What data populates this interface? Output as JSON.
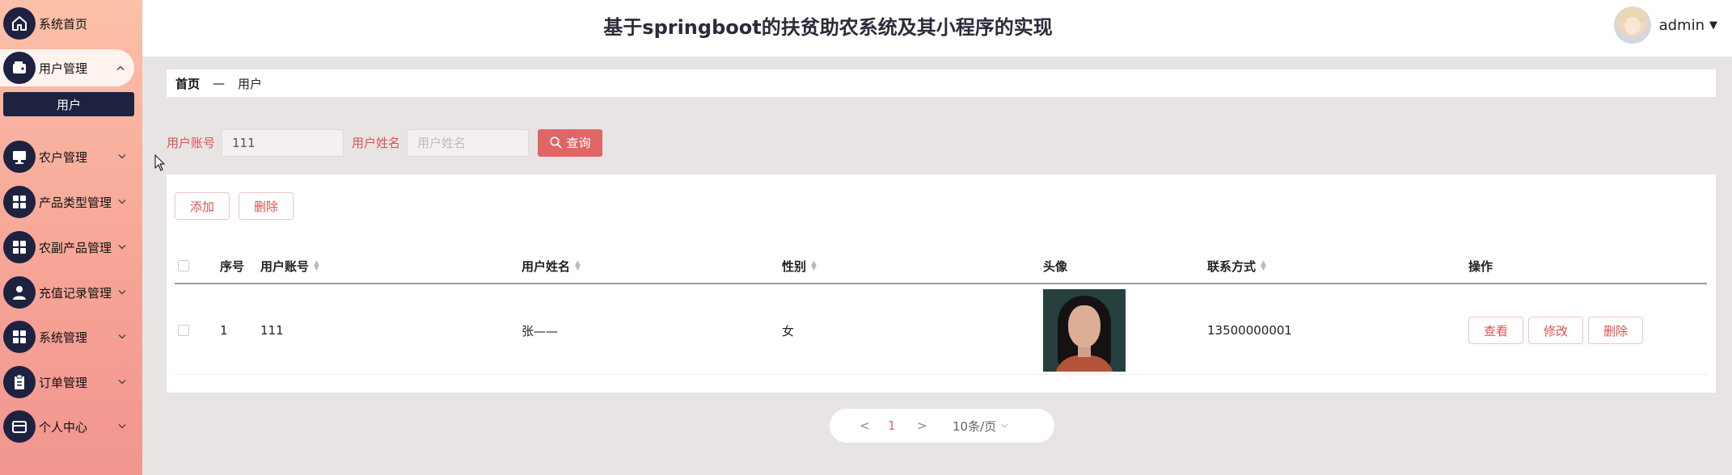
{
  "app": {
    "title": "基于springboot的扶贫助农系统及其小程序的实现"
  },
  "user": {
    "name": "admin",
    "caret": "▼"
  },
  "sidebar": {
    "items": [
      {
        "label": "系统首页",
        "icon": "home-icon"
      },
      {
        "label": "用户管理",
        "icon": "wallet-icon",
        "arrow": "^"
      },
      {
        "label": "农户管理",
        "icon": "monitor-icon",
        "arrow": "v"
      },
      {
        "label": "产品类型管理",
        "icon": "grid-icon",
        "arrow": "v"
      },
      {
        "label": "农副产品管理",
        "icon": "grid-icon",
        "arrow": "v"
      },
      {
        "label": "充值记录管理",
        "icon": "person-icon",
        "arrow": "v"
      },
      {
        "label": "系统管理",
        "icon": "grid-icon",
        "arrow": "v"
      },
      {
        "label": "订单管理",
        "icon": "clipboard-icon",
        "arrow": "v"
      },
      {
        "label": "个人中心",
        "icon": "card-icon",
        "arrow": "v"
      }
    ],
    "sub_item": "用户"
  },
  "breadcrumb": {
    "home": "首页",
    "separator": "—",
    "current": "用户"
  },
  "search": {
    "account_label": "用户账号",
    "account_value": "111",
    "name_label": "用户姓名",
    "name_placeholder": "用户姓名",
    "query_label": "查询"
  },
  "toolbar": {
    "add_label": "添加",
    "delete_label": "删除"
  },
  "table": {
    "columns": [
      "序号",
      "用户账号",
      "用户姓名",
      "性别",
      "头像",
      "联系方式",
      "操作"
    ],
    "rows": [
      {
        "index": "1",
        "account": "111",
        "name": "张——",
        "gender": "女",
        "phone": "13500000001",
        "actions": [
          "查看",
          "修改",
          "删除"
        ]
      }
    ]
  },
  "pagination": {
    "prev": "<",
    "page": "1",
    "next": ">",
    "page_size": "10条/页"
  },
  "colors": {
    "accent": "#e06565",
    "nav_dark": "#1d2240",
    "sidebar_top": "#fbc0a8",
    "sidebar_bottom": "#f2958f"
  }
}
